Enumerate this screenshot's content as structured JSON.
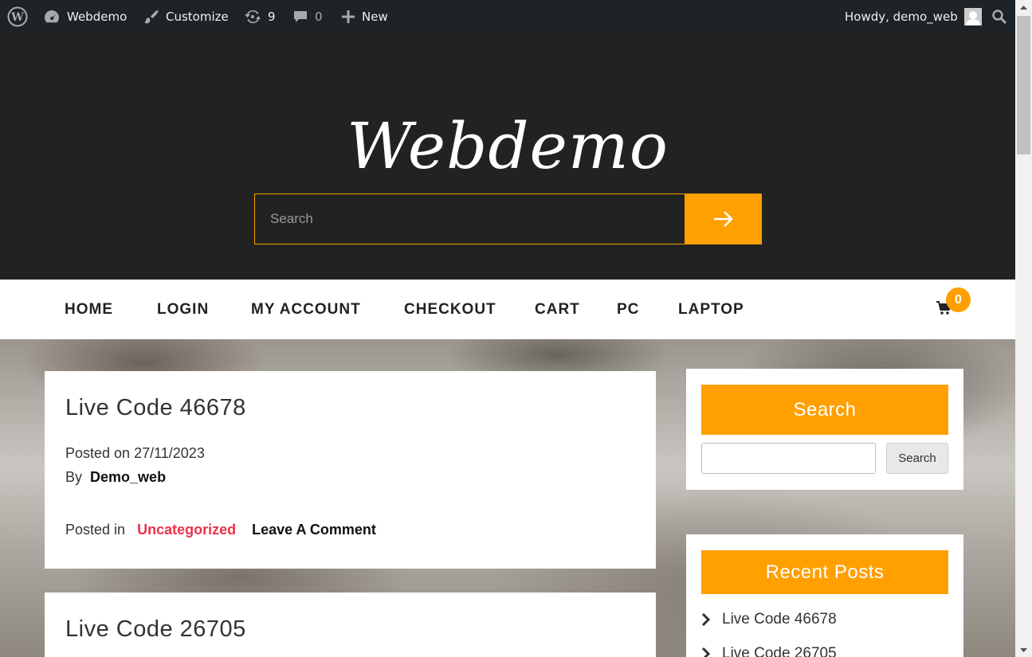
{
  "admin_bar": {
    "site_name": "Webdemo",
    "customize": "Customize",
    "updates_count": "9",
    "comments_count": "0",
    "new_label": "New",
    "greeting": "Howdy, demo_web"
  },
  "header": {
    "site_title": "Webdemo",
    "search_placeholder": "Search"
  },
  "nav": {
    "items": [
      "HOME",
      "LOGIN",
      "MY ACCOUNT",
      "CHECKOUT",
      "CART",
      "PC",
      "LAPTOP"
    ],
    "cart_count": "0"
  },
  "posts": [
    {
      "title": "Live Code 46678",
      "posted_on_label": "Posted on",
      "date": "27/11/2023",
      "by_label": "By",
      "author": "Demo_web",
      "posted_in_label": "Posted in",
      "category": "Uncategorized",
      "comment_link": "Leave A Comment"
    },
    {
      "title": "Live Code 26705"
    }
  ],
  "sidebar": {
    "search_widget": {
      "heading": "Search",
      "button": "Search"
    },
    "recent_posts": {
      "heading": "Recent Posts",
      "items": [
        "Live Code 46678",
        "Live Code 26705"
      ]
    }
  },
  "colors": {
    "accent": "#ff9f00",
    "category_red": "#e8334a",
    "admin_bar": "#1d2327",
    "header_bg": "#222222"
  }
}
